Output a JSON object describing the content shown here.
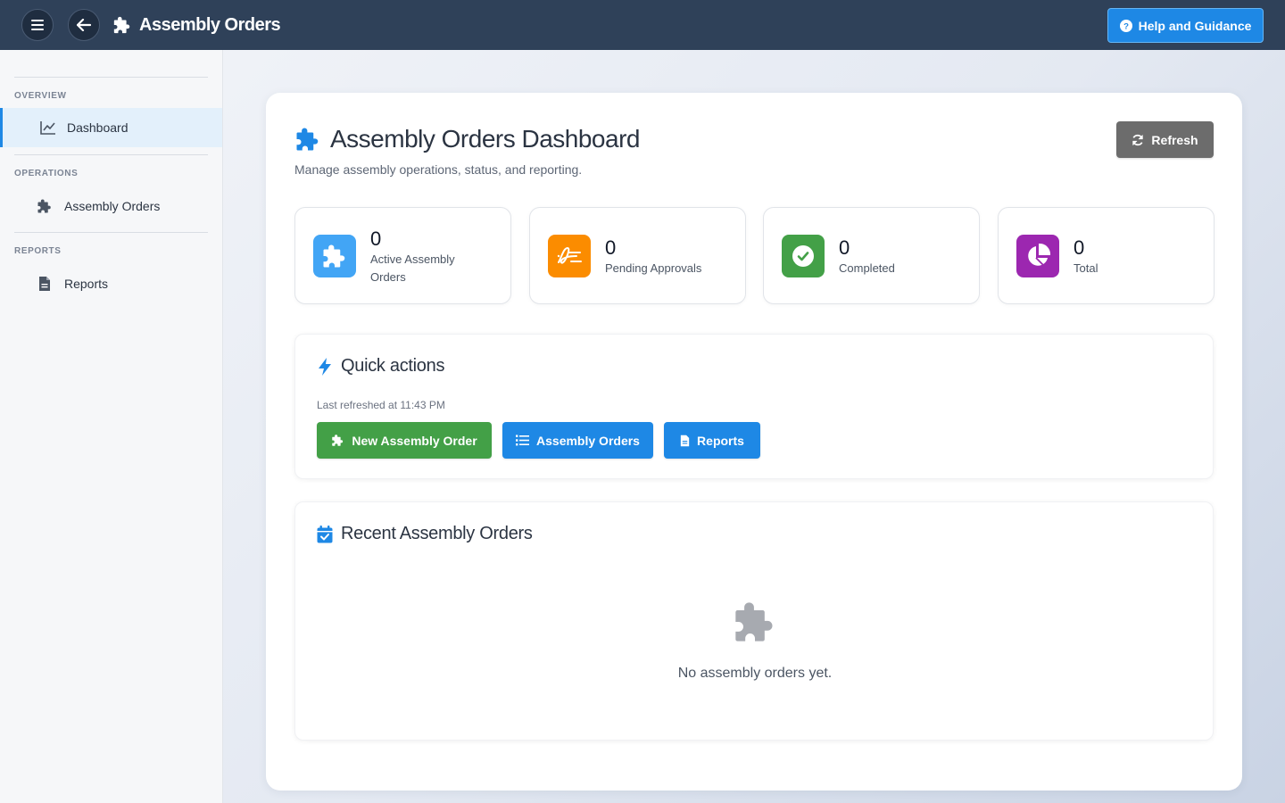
{
  "app": {
    "title": "Assembly Orders",
    "help_label": "Help and Guidance"
  },
  "sidebar": {
    "sections": [
      {
        "label": "Overview",
        "items": [
          {
            "label": "Dashboard",
            "icon": "chart-line-icon",
            "active": true
          }
        ]
      },
      {
        "label": "Operations",
        "items": [
          {
            "label": "Assembly Orders",
            "icon": "puzzle-icon",
            "active": false
          }
        ]
      },
      {
        "label": "Reports",
        "items": [
          {
            "label": "Reports",
            "icon": "document-icon",
            "active": false
          }
        ]
      }
    ]
  },
  "dashboard": {
    "title": "Assembly Orders Dashboard",
    "subtitle": "Manage assembly operations, status, and reporting.",
    "refresh_label": "Refresh"
  },
  "stats": [
    {
      "value": "0",
      "label": "Active Assembly Orders",
      "color": "#42a5f5",
      "icon": "puzzle-icon"
    },
    {
      "value": "0",
      "label": "Pending Approvals",
      "color": "#fb8c00",
      "icon": "signature-icon"
    },
    {
      "value": "0",
      "label": "Completed",
      "color": "#43a047",
      "icon": "check-circle-icon"
    },
    {
      "value": "0",
      "label": "Total",
      "color": "#9c27b0",
      "icon": "pie-chart-icon"
    }
  ],
  "quick_actions": {
    "title": "Quick actions",
    "last_refreshed": "Last refreshed at 11:43 PM",
    "buttons": [
      {
        "label": "New Assembly Order",
        "color": "#43a047",
        "icon": "puzzle-icon"
      },
      {
        "label": "Assembly Orders",
        "color": "#1e88e5",
        "icon": "list-icon"
      },
      {
        "label": "Reports",
        "color": "#1e88e5",
        "icon": "document-icon"
      }
    ]
  },
  "recent": {
    "title": "Recent Assembly Orders",
    "empty_message": "No assembly orders yet."
  },
  "colors": {
    "topbar": "#2f4159",
    "accent": "#1e88e5",
    "refresh_button": "#6c6c6c"
  }
}
